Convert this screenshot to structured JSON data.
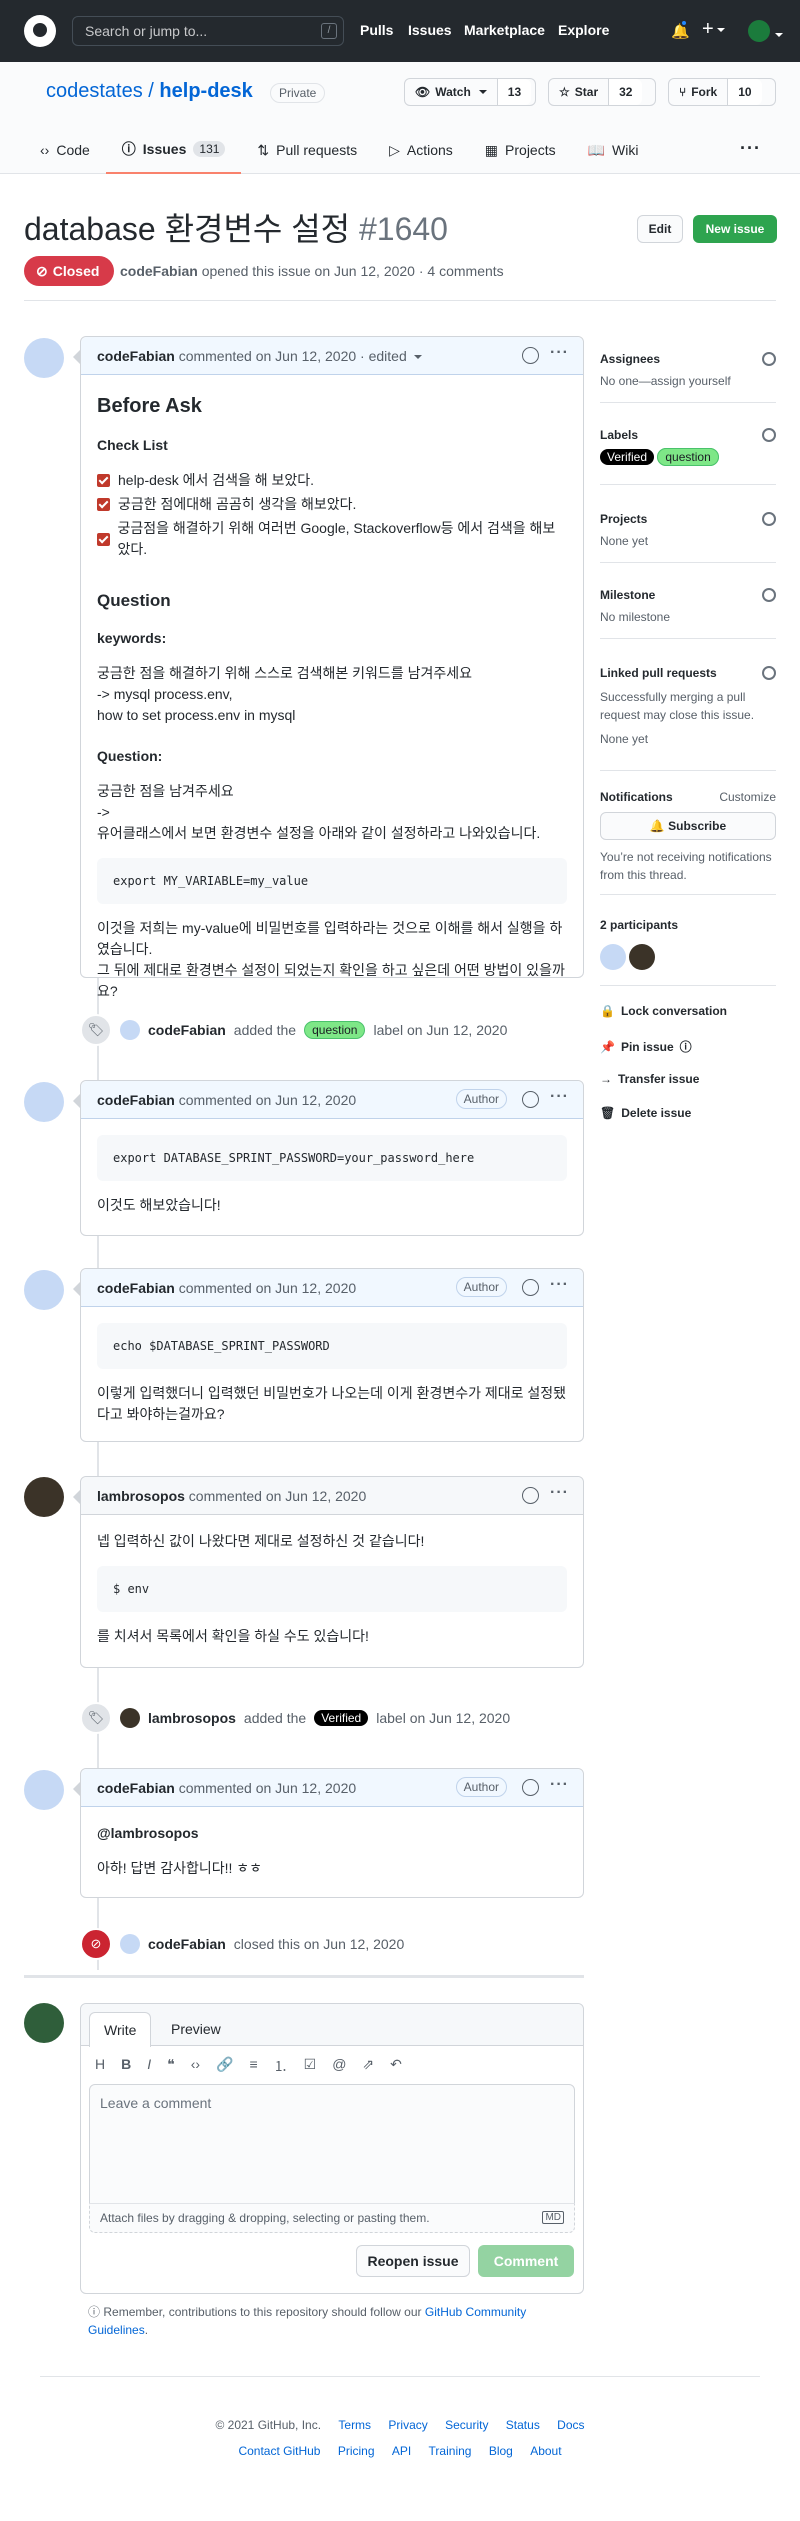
{
  "header": {
    "search_placeholder": "Search or jump to...",
    "slash": "/",
    "nav": [
      "Pulls",
      "Issues",
      "Marketplace",
      "Explore"
    ]
  },
  "repo": {
    "owner": "codestates",
    "sep": "/",
    "name": "help-desk",
    "visibility": "Private",
    "watch_label": "Watch",
    "watch_count": "13",
    "star_label": "Star",
    "star_count": "32",
    "fork_label": "Fork",
    "fork_count": "10"
  },
  "tabs": [
    {
      "label": "Code"
    },
    {
      "label": "Issues",
      "count": "131"
    },
    {
      "label": "Pull requests"
    },
    {
      "label": "Actions"
    },
    {
      "label": "Projects"
    },
    {
      "label": "Wiki"
    }
  ],
  "issue": {
    "title": "database 환경변수 설정",
    "number": "#1640",
    "edit": "Edit",
    "new_issue": "New issue",
    "state": "Closed",
    "author": "codeFabian",
    "meta": "opened this issue on Jun 12, 2020 · 4 comments"
  },
  "first_comment": {
    "author": "codeFabian",
    "meta": "commented on Jun 12, 2020 · edited",
    "h1": "Before Ask",
    "checklist_title": "Check List",
    "checklist": [
      "help-desk 에서 검색을 해 보았다.",
      "궁금한 점에대해 곰곰히 생각을 해보았다.",
      "궁금점을 해결하기 위해 여러번 Google, Stackoverflow등 에서 검색을 해보았다."
    ],
    "question_h": "Question",
    "keywords_h": "keywords:",
    "keywords_lines": [
      "궁금한 점을 해결하기 위해 스스로 검색해본 키워드를 남겨주세요",
      "-> mysql process.env,",
      "how to set process.env in mysql"
    ],
    "question2_h": "Question:",
    "question_lines": [
      "궁금한 점을 남겨주세요",
      "->",
      "유어클래스에서 보면 환경변수 설정을 아래와 같이 설정하라고 나와있습니다."
    ],
    "code": "export MY_VARIABLE=my_value",
    "tail_lines": [
      "이것을 저희는 my-value에 비밀번호를 입력하라는 것으로 이해를 해서 실행을 하였습니다.",
      "그 뒤에 제대로 환경변수 설정이 되었는지 확인을 하고 싶은데 어떤 방법이 있을까요?"
    ]
  },
  "event1": {
    "actor": "codeFabian",
    "pre": "added the",
    "label": "question",
    "post": "label on Jun 12, 2020"
  },
  "comment2": {
    "author": "codeFabian",
    "meta": "commented on Jun 12, 2020",
    "badge": "Author",
    "code": "export DATABASE_SPRINT_PASSWORD=your_password_here",
    "text": "이것도 해보았습니다!"
  },
  "comment3": {
    "author": "codeFabian",
    "meta": "commented on Jun 12, 2020",
    "badge": "Author",
    "code": "echo $DATABASE_SPRINT_PASSWORD",
    "text": "이렇게 입력했더니 입력했던 비밀번호가 나오는데 이게 환경변수가 제대로 설정됐다고 봐야하는걸까요?"
  },
  "comment4": {
    "author": "lambrosopos",
    "meta": "commented on Jun 12, 2020",
    "text1": "넵 입력하신 값이 나왔다면 제대로 설정하신 것 같습니다!",
    "code": "$ env",
    "text2": "를 치셔서 목록에서 확인을 하실 수도 있습니다!"
  },
  "event2": {
    "actor": "lambrosopos",
    "pre": "added the",
    "label": "Verified",
    "post": "label on Jun 12, 2020"
  },
  "comment5": {
    "author": "codeFabian",
    "meta": "commented on Jun 12, 2020",
    "badge": "Author",
    "mention": "@lambrosopos",
    "text": "아하! 답변 감사합니다!! ㅎㅎ"
  },
  "event3": {
    "actor": "codeFabian",
    "text": "closed this on Jun 12, 2020"
  },
  "editor": {
    "write": "Write",
    "preview": "Preview",
    "placeholder": "Leave a comment",
    "attach": "Attach files by dragging & dropping, selecting or pasting them.",
    "md": "MD",
    "reopen": "Reopen issue",
    "comment": "Comment",
    "note_pre": "Remember, contributions to this repository should follow our",
    "note_link": "GitHub Community Guidelines",
    "note_post": "."
  },
  "sidebar": {
    "assignees_h": "Assignees",
    "assignees_v": "No one—assign yourself",
    "labels_h": "Labels",
    "labels": [
      "Verified",
      "question"
    ],
    "projects_h": "Projects",
    "projects_v": "None yet",
    "milestone_h": "Milestone",
    "milestone_v": "No milestone",
    "linked_h": "Linked pull requests",
    "linked_desc": "Successfully merging a pull request may close this issue.",
    "linked_v": "None yet",
    "notif_h": "Notifications",
    "customize": "Customize",
    "subscribe": "Subscribe",
    "notif_desc": "You’re not receiving notifications from this thread.",
    "participants_h": "2 participants",
    "lock": "Lock conversation",
    "pin": "Pin issue",
    "transfer": "Transfer issue",
    "delete": "Delete issue"
  },
  "footer": {
    "copyright": "© 2021 GitHub, Inc.",
    "row1": [
      "Terms",
      "Privacy",
      "Security",
      "Status",
      "Docs"
    ],
    "row2": [
      "Contact GitHub",
      "Pricing",
      "API",
      "Training",
      "Blog",
      "About"
    ]
  },
  "colors": {
    "closed": "#d73a49",
    "green": "#2ea44f",
    "header": "#24292e",
    "link": "#0366d6"
  }
}
